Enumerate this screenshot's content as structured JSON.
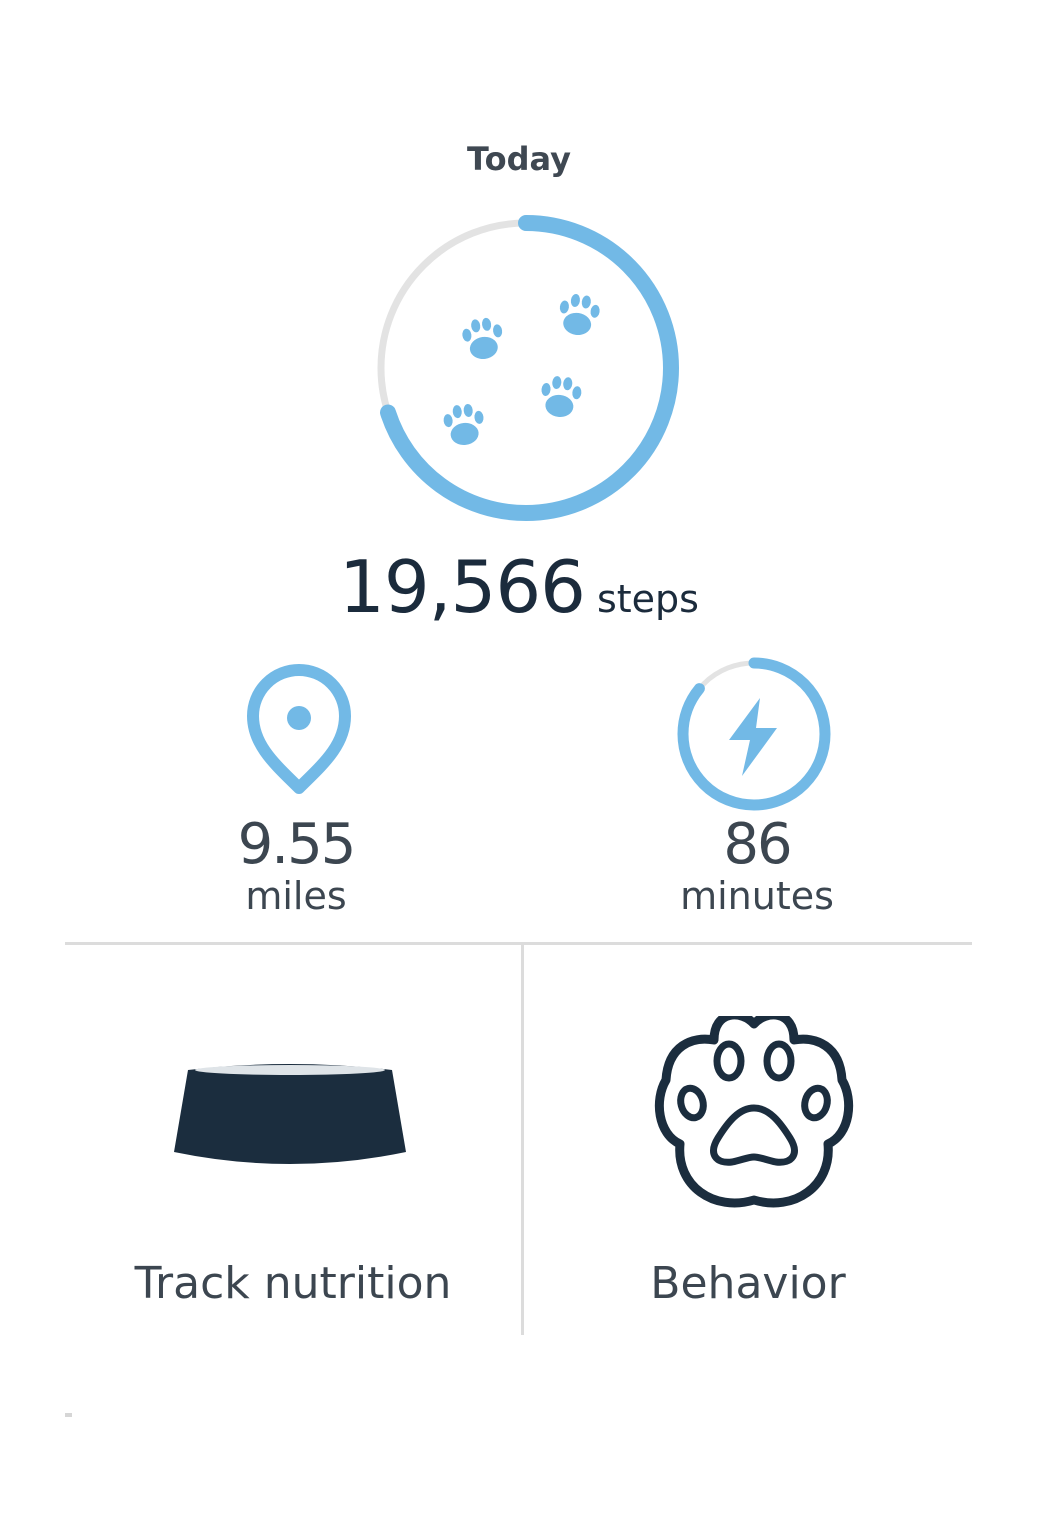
{
  "header": {
    "title": "Today"
  },
  "steps": {
    "value": "19,566",
    "unit": "steps",
    "goal_progress": 0.7,
    "ring_icon": "paw-prints-icon"
  },
  "distance": {
    "value": "9.55",
    "unit": "miles",
    "icon": "location-pin-icon"
  },
  "active": {
    "value": "86",
    "unit": "minutes",
    "goal_progress": 0.86,
    "icon": "lightning-bolt-icon"
  },
  "cards": [
    {
      "label": "Track nutrition",
      "icon": "food-bowl-icon"
    },
    {
      "label": "Behavior",
      "icon": "paw-icon"
    }
  ],
  "colors": {
    "accent": "#72b9e6",
    "track": "#e3e3e3",
    "dark": "#1b2d3e",
    "text": "#3c4650",
    "divider": "#dcdcdc"
  }
}
